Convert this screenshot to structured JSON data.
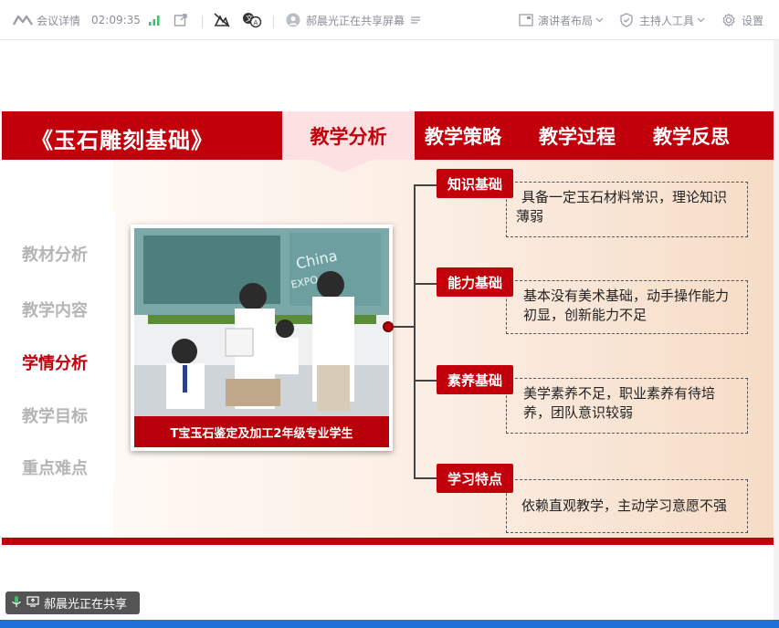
{
  "toolbar": {
    "meeting_info": "会议详情",
    "timer": "02:09:35",
    "sharer_status": "郝晨光正在共享屏幕",
    "presenter_layout": "演讲者布局",
    "host_tools": "主持人工具",
    "settings": "设置"
  },
  "slide": {
    "course_title": "《玉石雕刻基础》",
    "tabs": [
      {
        "label": "教学分析"
      },
      {
        "label": "教学策略"
      },
      {
        "label": "教学过程"
      },
      {
        "label": "教学反思"
      }
    ],
    "sidebar": [
      {
        "label": "教材分析"
      },
      {
        "label": "教学内容"
      },
      {
        "label": "学情分析"
      },
      {
        "label": "教学目标"
      },
      {
        "label": "重点难点"
      }
    ],
    "photo_caption": "T宝玉石鉴定及加工2年级专业学生",
    "items": [
      {
        "tag": "知识基础",
        "text": "具备一定玉石材料常识，理论知识薄弱"
      },
      {
        "tag": "能力基础",
        "text": "基本没有美术基础，动手操作能力初显，创新能力不足"
      },
      {
        "tag": "素养基础",
        "text": "美学素养不足，职业素养有待培养，团队意识较弱"
      },
      {
        "tag": "学习特点",
        "text": "依赖直观教学，主动学习意愿不强"
      }
    ]
  },
  "share_overlay": {
    "label": "郝晨光正在共享"
  },
  "colors": {
    "brand_red": "#c1000b",
    "tab_active_bg": "#fde0e2",
    "taskbar_blue": "#1e6fd8"
  }
}
